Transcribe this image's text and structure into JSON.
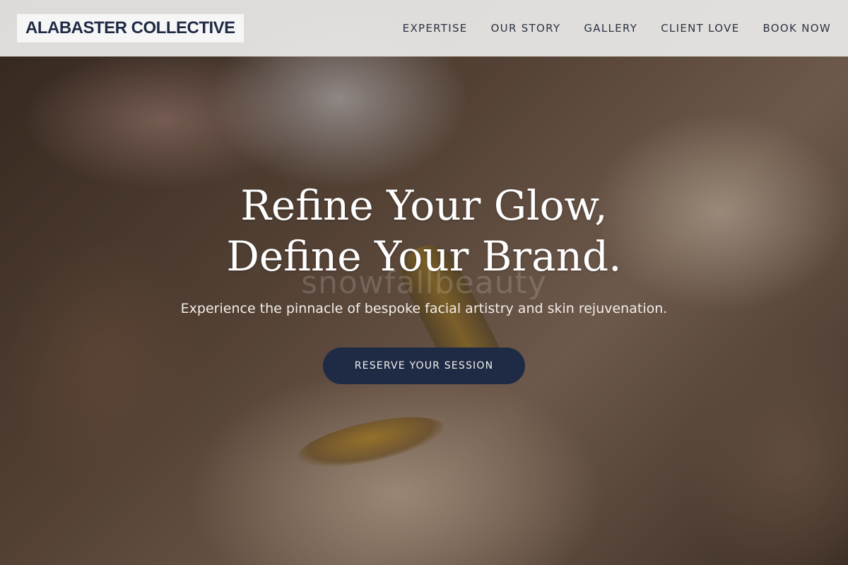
{
  "header": {
    "brand": "ALABASTER COLLECTIVE",
    "nav": [
      {
        "label": "EXPERTISE"
      },
      {
        "label": "OUR STORY"
      },
      {
        "label": "GALLERY"
      },
      {
        "label": "CLIENT LOVE"
      },
      {
        "label": "BOOK NOW"
      }
    ]
  },
  "hero": {
    "title_line1": "Refine Your Glow,",
    "title_line2": "Define Your Brand.",
    "watermark": "snowfallbeauty",
    "subtitle": "Experience the pinnacle of bespoke facial artistry and skin rejuvenation.",
    "cta_label": "RESERVE YOUR SESSION"
  },
  "colors": {
    "brand_navy": "#1f2b45",
    "header_bg": "#ebe9e7",
    "nav_text": "#2d3344"
  }
}
